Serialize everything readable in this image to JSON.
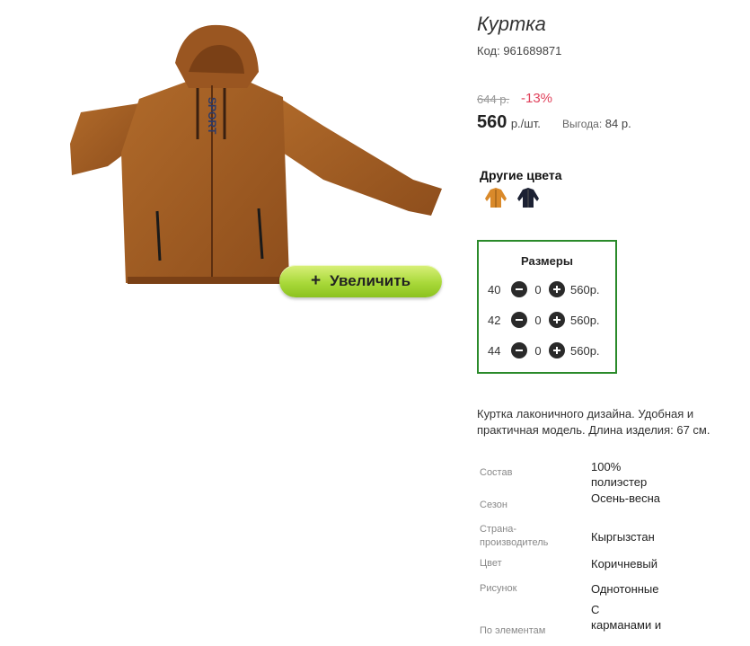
{
  "product": {
    "title": "Куртка",
    "code": "Код: 961689871",
    "old_price": "644 р.",
    "discount": "-13%",
    "price": "560",
    "price_unit": "р./шт.",
    "savings_label": "Выгода:",
    "savings_value": "84 р.",
    "zoom_label": "Увеличить",
    "zoom_icon": "+"
  },
  "other_colors": {
    "title": "Другие цвета",
    "swatches": [
      {
        "name": "brown-jacket",
        "color": "#d9892a"
      },
      {
        "name": "navy-jacket",
        "color": "#1c2133"
      }
    ]
  },
  "sizes": {
    "title": "Размеры",
    "rows": [
      {
        "size": "40",
        "qty": "0",
        "price": "560р."
      },
      {
        "size": "42",
        "qty": "0",
        "price": "560р."
      },
      {
        "size": "44",
        "qty": "0",
        "price": "560р."
      }
    ]
  },
  "description": "Куртка лаконичного дизайна. Удобная и практичная модель. Длина изделия: 67 см.",
  "specs": [
    {
      "label": "Состав",
      "value": "100% полиэстер"
    },
    {
      "label": "Сезон",
      "value": "Осень-весна"
    },
    {
      "label": "Страна-производитель",
      "value": "Кыргызстан"
    },
    {
      "label": "Цвет",
      "value": "Коричневый"
    },
    {
      "label": "Рисунок",
      "value": "Однотонные"
    },
    {
      "label": "По элементам",
      "value": "С карманами и"
    }
  ],
  "image": {
    "print_text": "SPORT",
    "jacket_color": "#a65d22"
  }
}
